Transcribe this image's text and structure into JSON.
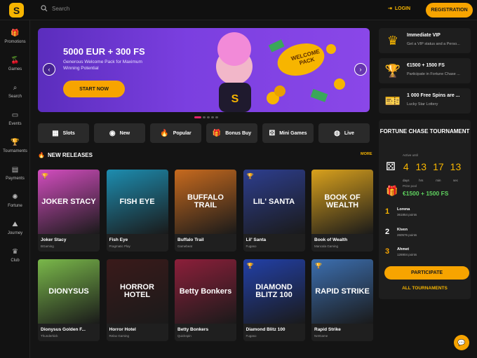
{
  "header": {
    "logo_letter": "S",
    "search_placeholder": "Search",
    "login_label": "LOGIN",
    "register_label": "REGISTRATION"
  },
  "sidebar": {
    "items": [
      {
        "label": "Promotions",
        "icon": "gift-icon"
      },
      {
        "label": "Games",
        "icon": "cherry-icon"
      },
      {
        "label": "Search",
        "icon": "search-icon"
      },
      {
        "label": "Events",
        "icon": "calendar-icon"
      },
      {
        "label": "Tournaments",
        "icon": "trophy-icon"
      },
      {
        "label": "Payments",
        "icon": "card-icon"
      },
      {
        "label": "Fortune",
        "icon": "wheel-icon"
      },
      {
        "label": "Journey",
        "icon": "map-icon"
      },
      {
        "label": "Club",
        "icon": "crown-icon"
      }
    ]
  },
  "hero": {
    "title": "5000 EUR + 300 FS",
    "subtitle": "Generous Welcome Pack for Maximum Winning Potential",
    "button": "START NOW",
    "badge": "WELCOME PACK",
    "badge_color": "#f7b500"
  },
  "categories": [
    {
      "label": "Slots",
      "icon": "slot-icon"
    },
    {
      "label": "New",
      "icon": "new-icon"
    },
    {
      "label": "Popular",
      "icon": "flame-icon"
    },
    {
      "label": "Bonus Buy",
      "icon": "gift-icon"
    },
    {
      "label": "Mini Games",
      "icon": "dice-icon"
    },
    {
      "label": "Live",
      "icon": "globe-icon"
    }
  ],
  "new_releases": {
    "title": "NEW RELEASES",
    "more": "MORE",
    "games": [
      {
        "name": "Joker Stacy",
        "provider": "BGaming",
        "art": "JOKER STACY",
        "bg": "#d34dbf",
        "trophy": true
      },
      {
        "name": "Fish Eye",
        "provider": "Pragmatic Play",
        "art": "FISH EYE",
        "bg": "#1d8db0",
        "trophy": false
      },
      {
        "name": "Buffalo Trail",
        "provider": "Gamebeat",
        "art": "BUFFALO TRAIL",
        "bg": "#c76a1e",
        "trophy": false
      },
      {
        "name": "Lil' Santa",
        "provider": "Fugaso",
        "art": "LIL' SANTA",
        "bg": "#2d3e8f",
        "trophy": true
      },
      {
        "name": "Book of Wealth",
        "provider": "Mancala Gaming",
        "art": "BOOK OF WEALTH",
        "bg": "#d9a11c",
        "trophy": false
      },
      {
        "name": "Dionysus Golden F...",
        "provider": "Thunderkick",
        "art": "DIONYSUS",
        "bg": "#7ab84a",
        "trophy": false
      },
      {
        "name": "Horror Hotel",
        "provider": "Relax Gaming",
        "art": "HORROR HOTEL",
        "bg": "#3a1a1a",
        "trophy": false
      },
      {
        "name": "Betty Bonkers",
        "provider": "Quickspin",
        "art": "Betty Bonkers",
        "bg": "#8c1f3a",
        "trophy": false
      },
      {
        "name": "Diamond Blitz 100",
        "provider": "Fugaso",
        "art": "DIAMOND BLITZ 100",
        "bg": "#2240a8",
        "trophy": true
      },
      {
        "name": "Rapid Strike",
        "provider": "NetGame",
        "art": "RAPID STRIKE",
        "bg": "#3c6fb0",
        "trophy": true
      }
    ]
  },
  "promos": [
    {
      "title": "Immediate VIP",
      "subtitle": "Get a VIP status and a Perso...",
      "icon": "crown-icon"
    },
    {
      "title": "€1500 + 1500 FS",
      "subtitle": "Participate in Fortune Chase ...",
      "icon": "trophy-icon"
    },
    {
      "title": "1 000 Free Spins are ...",
      "subtitle": "Lucky Star Lottery",
      "icon": "ticket-icon"
    }
  ],
  "tournament": {
    "title": "FORTUNE CHASE TOURNAMENT",
    "active_label": "Active until",
    "timer": [
      {
        "value": "4",
        "unit": "days"
      },
      {
        "value": "13",
        "unit": "hrs"
      },
      {
        "value": "17",
        "unit": "min"
      },
      {
        "value": "13",
        "unit": "sec"
      }
    ],
    "prize_label": "Prize pool",
    "prize": "€1500 + 1500 FS",
    "leaders": [
      {
        "rank": "1",
        "name": "Lorena",
        "points": "361854 points",
        "color": "#f7b500"
      },
      {
        "rank": "2",
        "name": "Kiven",
        "points": "260576 points",
        "color": "#ffffff"
      },
      {
        "rank": "3",
        "name": "Ahmet",
        "points": "126904 points",
        "color": "#f7a400"
      }
    ],
    "participate": "PARTICIPATE",
    "all_tournaments": "ALL TOURNAMENTS"
  }
}
